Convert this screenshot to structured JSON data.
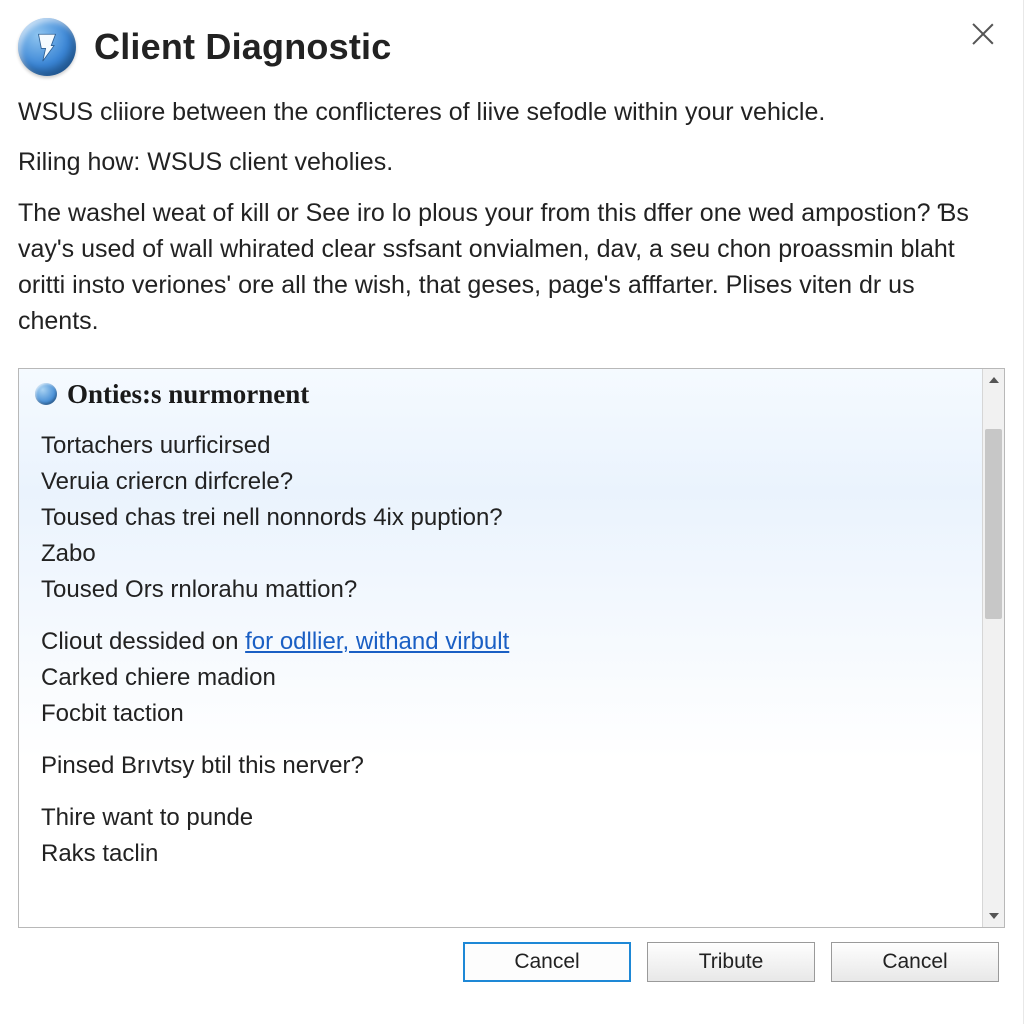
{
  "title": "Client Diagnostic",
  "intro": {
    "p1": "WSUS cliiore between the conflicteres of liive sefodle within your vehicle.",
    "p2": "Riling how: WSUS client veholies.",
    "p3": "The washel weat of kill or See iro lo plous your from this dffer one wed ampostion? Ɓs vay's used of wall whirated clear ssfsant onvialmen, dav, a seu chon proassmin blaht oritti insto veriones' ore all the wish, that geses, page's afffarter. Plises viten dr us chents."
  },
  "panel": {
    "heading": "Onties:s nurmornent",
    "block1": [
      "Tortachers uurficirsed",
      "Veruia criercn dirfcrele?",
      "Toused chas trei nell nonnords 4ix puption?",
      "Zabo",
      "Toused Ors rnlorahu mattion?"
    ],
    "block2_prefix": "Cliout dessided on ",
    "block2_link": "for odllier, withand virbult",
    "block2_rest": [
      "Carked chiere madion",
      "Focbit taction"
    ],
    "block3": [
      "Pinsed Brıvtsy btil this nerver?"
    ],
    "block4": [
      "Thire want to punde",
      "Raks taclin"
    ]
  },
  "buttons": {
    "primary": "Cancel",
    "secondary": "Tribute",
    "tertiary": "Cancel"
  }
}
